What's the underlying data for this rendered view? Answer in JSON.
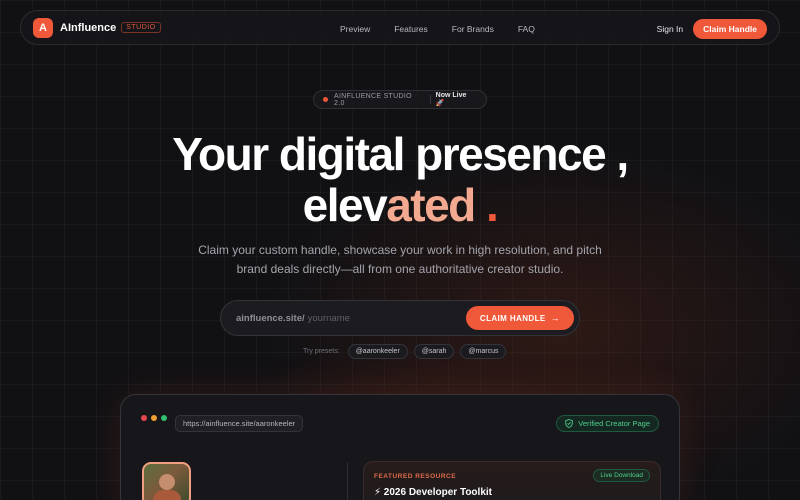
{
  "nav": {
    "logo_letter": "A",
    "brand": "AInfluence",
    "brand_tag": "STUDIO",
    "links": [
      "Preview",
      "Features",
      "For Brands",
      "FAQ"
    ],
    "sign_in": "Sign In",
    "cta": "Claim Handle"
  },
  "announcement": {
    "label": "AINFLUENCE STUDIO 2.0",
    "status": "Now Live 🚀"
  },
  "hero": {
    "line1": "Your digital presence ,",
    "line2_part1": "elev",
    "line2_part2": "ated",
    "line2_part3": " ."
  },
  "subtitle": "Claim your custom handle, showcase your work in high resolution, and pitch brand deals directly—all from one authoritative creator studio.",
  "claim": {
    "prefix": "ainfluence.site/",
    "placeholder": "yourname",
    "button": "CLAIM HANDLE",
    "button_icon": "arrow-right-icon"
  },
  "presets": {
    "label": "Try presets:",
    "items": [
      "@aaronkeeler",
      "@sarah",
      "@marcus"
    ]
  },
  "preview": {
    "window_dots": [
      "#e5484d",
      "#f0a030",
      "#30c070"
    ],
    "url": "https://ainfluence.site/aaronkeeler",
    "verified": "Verified Creator Page",
    "verified_icon": "shield-check-icon",
    "featured_label": "FEATURED RESOURCE",
    "featured_tag": "Live Download",
    "featured_title": "⚡ 2026 Developer Toolkit"
  },
  "colors": {
    "accent": "#f0583a",
    "accent_light": "#f3a98f",
    "verified_green": "#4fcf8e",
    "background": "#111114"
  }
}
